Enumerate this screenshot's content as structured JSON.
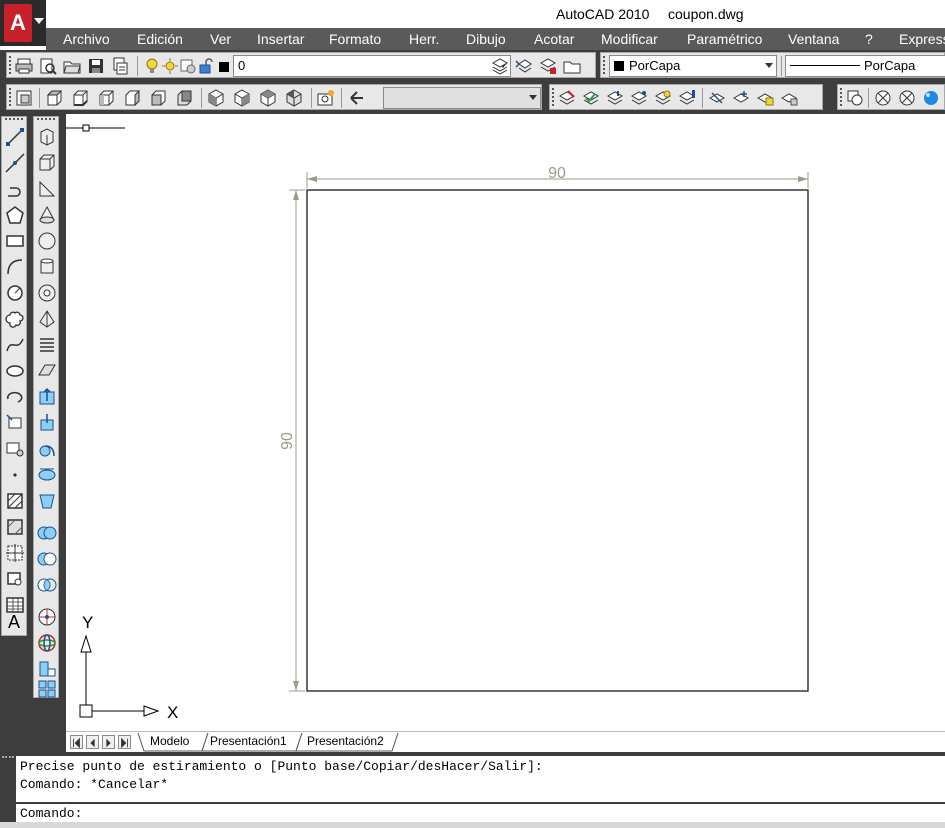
{
  "window": {
    "app_title": "AutoCAD 2010",
    "file_name": "coupon.dwg"
  },
  "app_button": {
    "logo_letter": "A"
  },
  "menu": {
    "items": [
      "Archivo",
      "Edición",
      "Ver",
      "Insertar",
      "Formato",
      "Herr.",
      "Dibujo",
      "Acotar",
      "Modificar",
      "Paramétrico",
      "Ventana",
      "?",
      "Express"
    ]
  },
  "toolbar": {
    "layer_value": "0",
    "color_value": "PorCapa",
    "linetype_value": "PorCapa",
    "view_combo_value": ""
  },
  "drawing": {
    "dim_horizontal": "90",
    "dim_vertical": "90",
    "ucs_x_label": "X",
    "ucs_y_label": "Y"
  },
  "tabs": [
    "Modelo",
    "Presentación1",
    "Presentación2"
  ],
  "command": {
    "history": [
      "Precise punto de estiramiento o [Punto base/Copiar/desHacer/Salir]:",
      "Comando: *Cancelar*"
    ],
    "prompt": "Comando:"
  },
  "colors": {
    "menu_bg": "#5a5a5a",
    "dock_bg": "#3d3d3d",
    "app_red": "#c8202a",
    "dimension_color": "#9b9b8a"
  }
}
